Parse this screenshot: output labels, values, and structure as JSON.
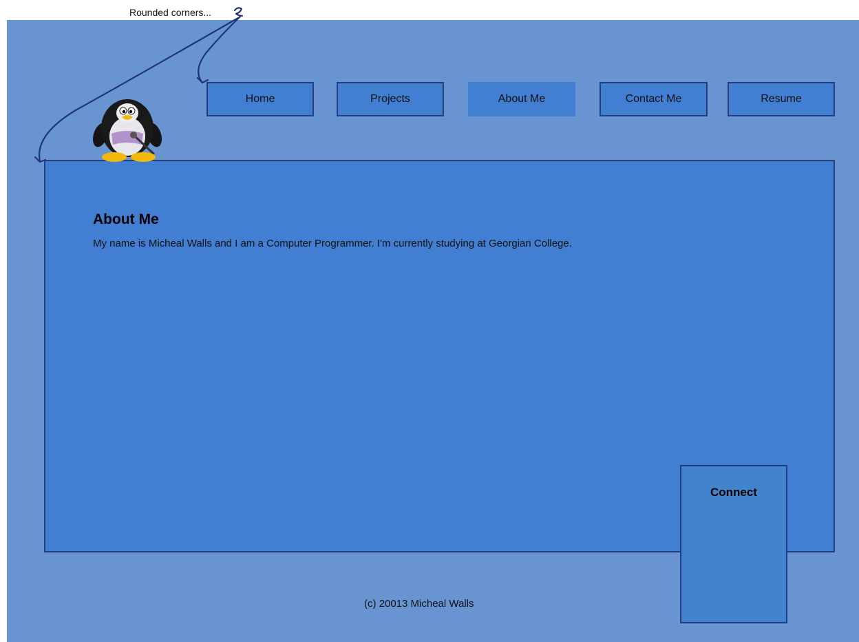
{
  "annotation": {
    "label": "Rounded corners..."
  },
  "nav": {
    "items": [
      {
        "label": "Home"
      },
      {
        "label": "Projects"
      },
      {
        "label": "About Me",
        "active": true
      },
      {
        "label": "Contact Me"
      },
      {
        "label": "Resume"
      }
    ]
  },
  "main": {
    "heading": "About Me",
    "body": "My name is Micheal Walls and I am a Computer Programmer. I'm currently studying at Georgian College."
  },
  "sidebar": {
    "connect_title": "Connect"
  },
  "footer": {
    "text": "(c) 20013 Micheal Walls"
  },
  "colors": {
    "page_background": "#6894d2",
    "panel_blue": "#427ed2",
    "border_navy": "#253f7c",
    "connect_blue": "#4284cc",
    "annotation_arrow": "#22347a"
  },
  "icons": {
    "logo": "penguin-icon"
  }
}
